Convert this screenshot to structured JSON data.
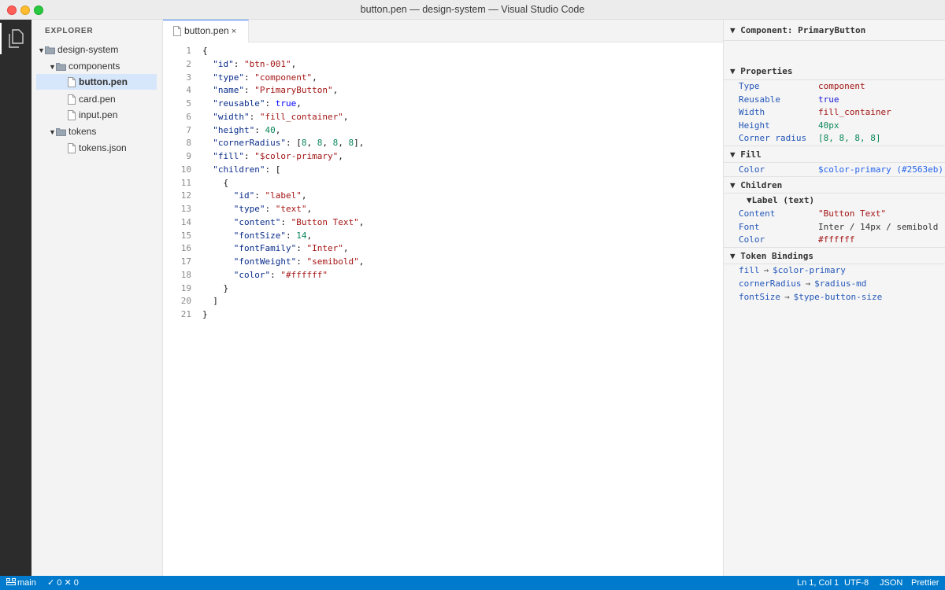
{
  "window": {
    "title": "button.pen — design-system — Visual Studio Code"
  },
  "sidebar": {
    "title": "EXPLORER",
    "tree": [
      {
        "label": "design-system",
        "kind": "folder",
        "expanded": true,
        "depth": 0
      },
      {
        "label": "components",
        "kind": "folder",
        "expanded": true,
        "depth": 1
      },
      {
        "label": "button.pen",
        "kind": "file",
        "depth": 2,
        "selected": true
      },
      {
        "label": "card.pen",
        "kind": "file",
        "depth": 2
      },
      {
        "label": "input.pen",
        "kind": "file",
        "depth": 2
      },
      {
        "label": "tokens",
        "kind": "folder",
        "expanded": true,
        "depth": 1
      },
      {
        "label": "tokens.json",
        "kind": "file",
        "depth": 2
      }
    ]
  },
  "editor": {
    "tab": {
      "label": "button.pen",
      "close": "×"
    },
    "lines": [
      [
        [
          "p",
          "{"
        ]
      ],
      [
        [
          "p",
          "  "
        ],
        [
          "k",
          "\"id\""
        ],
        [
          "p",
          ": "
        ],
        [
          "s",
          "\"btn-001\""
        ],
        [
          "p",
          ","
        ]
      ],
      [
        [
          "p",
          "  "
        ],
        [
          "k",
          "\"type\""
        ],
        [
          "p",
          ": "
        ],
        [
          "s",
          "\"component\""
        ],
        [
          "p",
          ","
        ]
      ],
      [
        [
          "p",
          "  "
        ],
        [
          "k",
          "\"name\""
        ],
        [
          "p",
          ": "
        ],
        [
          "s",
          "\"PrimaryButton\""
        ],
        [
          "p",
          ","
        ]
      ],
      [
        [
          "p",
          "  "
        ],
        [
          "k",
          "\"reusable\""
        ],
        [
          "p",
          ": "
        ],
        [
          "b",
          "true"
        ],
        [
          "p",
          ","
        ]
      ],
      [
        [
          "p",
          "  "
        ],
        [
          "k",
          "\"width\""
        ],
        [
          "p",
          ": "
        ],
        [
          "s",
          "\"fill_container\""
        ],
        [
          "p",
          ","
        ]
      ],
      [
        [
          "p",
          "  "
        ],
        [
          "k",
          "\"height\""
        ],
        [
          "p",
          ": "
        ],
        [
          "n",
          "40"
        ],
        [
          "p",
          ","
        ]
      ],
      [
        [
          "p",
          "  "
        ],
        [
          "k",
          "\"cornerRadius\""
        ],
        [
          "p",
          ": ["
        ],
        [
          "n",
          "8"
        ],
        [
          "p",
          ", "
        ],
        [
          "n",
          "8"
        ],
        [
          "p",
          ", "
        ],
        [
          "n",
          "8"
        ],
        [
          "p",
          ", "
        ],
        [
          "n",
          "8"
        ],
        [
          "p",
          "],"
        ]
      ],
      [
        [
          "p",
          "  "
        ],
        [
          "k",
          "\"fill\""
        ],
        [
          "p",
          ": "
        ],
        [
          "s",
          "\"$color-primary\""
        ],
        [
          "p",
          ","
        ]
      ],
      [
        [
          "p",
          "  "
        ],
        [
          "k",
          "\"children\""
        ],
        [
          "p",
          ": ["
        ]
      ],
      [
        [
          "p",
          "    {"
        ]
      ],
      [
        [
          "p",
          "      "
        ],
        [
          "k",
          "\"id\""
        ],
        [
          "p",
          ": "
        ],
        [
          "s",
          "\"label\""
        ],
        [
          "p",
          ","
        ]
      ],
      [
        [
          "p",
          "      "
        ],
        [
          "k",
          "\"type\""
        ],
        [
          "p",
          ": "
        ],
        [
          "s",
          "\"text\""
        ],
        [
          "p",
          ","
        ]
      ],
      [
        [
          "p",
          "      "
        ],
        [
          "k",
          "\"content\""
        ],
        [
          "p",
          ": "
        ],
        [
          "s",
          "\"Button Text\""
        ],
        [
          "p",
          ","
        ]
      ],
      [
        [
          "p",
          "      "
        ],
        [
          "k",
          "\"fontSize\""
        ],
        [
          "p",
          ": "
        ],
        [
          "n",
          "14"
        ],
        [
          "p",
          ","
        ]
      ],
      [
        [
          "p",
          "      "
        ],
        [
          "k",
          "\"fontFamily\""
        ],
        [
          "p",
          ": "
        ],
        [
          "s",
          "\"Inter\""
        ],
        [
          "p",
          ","
        ]
      ],
      [
        [
          "p",
          "      "
        ],
        [
          "k",
          "\"fontWeight\""
        ],
        [
          "p",
          ": "
        ],
        [
          "s",
          "\"semibold\""
        ],
        [
          "p",
          ","
        ]
      ],
      [
        [
          "p",
          "      "
        ],
        [
          "k",
          "\"color\""
        ],
        [
          "p",
          ": "
        ],
        [
          "s",
          "\"#ffffff\""
        ]
      ],
      [
        [
          "p",
          "    }"
        ]
      ],
      [
        [
          "p",
          "  ]"
        ]
      ],
      [
        [
          "p",
          "}"
        ]
      ]
    ]
  },
  "inspector": {
    "component_header": "▼ Component: PrimaryButton",
    "properties": {
      "header": "▼ Properties",
      "rows": [
        {
          "key": "Type",
          "value": "component",
          "tone": "red"
        },
        {
          "key": "Reusable",
          "value": "true",
          "tone": "blue"
        },
        {
          "key": "Width",
          "value": "fill_container",
          "tone": "red"
        },
        {
          "key": "Height",
          "value": "40px",
          "tone": "green"
        },
        {
          "key": "Corner radius",
          "value": "[8, 8, 8, 8]",
          "tone": "green"
        }
      ]
    },
    "fill": {
      "header": "▼ Fill",
      "rows": [
        {
          "key": "Color",
          "value": "$color-primary (#2563eb)",
          "tone": "link"
        }
      ]
    },
    "children": {
      "header": "▼ Children",
      "child_title": "▼Label (text)",
      "rows": [
        {
          "key": "Content",
          "value": "\"Button Text\"",
          "tone": "red"
        },
        {
          "key": "Font",
          "value": "Inter / 14px / semibold",
          "tone": "plain"
        },
        {
          "key": "Color",
          "value": "#ffffff",
          "tone": "red"
        }
      ]
    },
    "token_bindings": {
      "header": "▼ Token Bindings",
      "items": [
        {
          "property": "fillToken",
          "label": "fill",
          "arrow": "→",
          "token": "$color-primary"
        },
        {
          "property": "cornerRadius",
          "label": "cornerRadius",
          "arrow": "→",
          "token": "$radius-md"
        },
        {
          "property": "fontSize",
          "label": "fontSize",
          "arrow": "→",
          "token": "$type-button-size"
        }
      ]
    }
  },
  "statusbar": {
    "branch": "main",
    "problems": "✓ 0 ✕ 0",
    "position": "Ln 1, Col 1",
    "encoding": "UTF-8",
    "language": "JSON",
    "formatter": "Prettier"
  },
  "colors": {
    "accent": "#007acc",
    "selection": "#d6e6fb",
    "json_key": "#0a2d8a",
    "json_string": "#a31515",
    "json_number": "#098658",
    "json_boolean": "#0000ff"
  },
  "icons": {
    "activity": "files-icon",
    "folder": "folder-icon",
    "file": "file-icon",
    "branch": "source-control-icon"
  }
}
